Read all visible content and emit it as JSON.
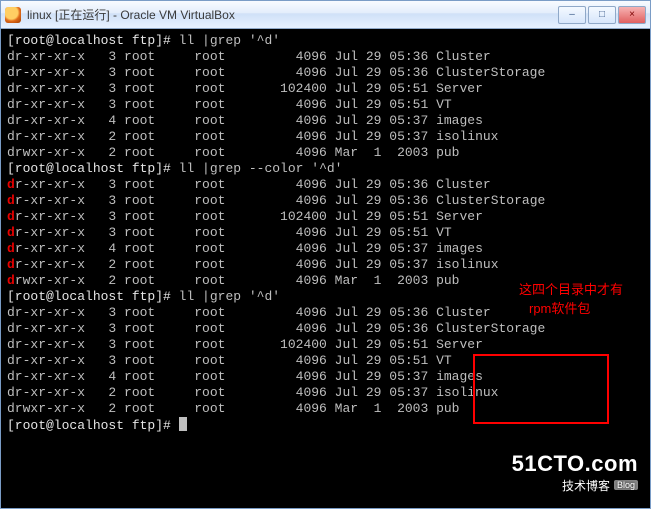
{
  "window": {
    "title": "linux [正在运行] - Oracle VM VirtualBox",
    "buttons": {
      "min": "–",
      "max": "□",
      "close": "×"
    }
  },
  "prompt": {
    "host": "[root@localhost ftp]# ",
    "cmd1": "ll |grep '^d'",
    "cmd2": "ll |grep --color '^d'",
    "cmd3": "ll |grep '^d'"
  },
  "listings": [
    {
      "perm": "dr-xr-xr-x",
      "links": "3",
      "owner": "root",
      "group": "root",
      "size": "4096",
      "date": "Jul 29 05:36",
      "name": "Cluster"
    },
    {
      "perm": "dr-xr-xr-x",
      "links": "3",
      "owner": "root",
      "group": "root",
      "size": "4096",
      "date": "Jul 29 05:36",
      "name": "ClusterStorage"
    },
    {
      "perm": "dr-xr-xr-x",
      "links": "3",
      "owner": "root",
      "group": "root",
      "size": "102400",
      "date": "Jul 29 05:51",
      "name": "Server"
    },
    {
      "perm": "dr-xr-xr-x",
      "links": "3",
      "owner": "root",
      "group": "root",
      "size": "4096",
      "date": "Jul 29 05:51",
      "name": "VT"
    },
    {
      "perm": "dr-xr-xr-x",
      "links": "4",
      "owner": "root",
      "group": "root",
      "size": "4096",
      "date": "Jul 29 05:37",
      "name": "images"
    },
    {
      "perm": "dr-xr-xr-x",
      "links": "2",
      "owner": "root",
      "group": "root",
      "size": "4096",
      "date": "Jul 29 05:37",
      "name": "isolinux"
    },
    {
      "perm": "drwxr-xr-x",
      "links": "2",
      "owner": "root",
      "group": "root",
      "size": "4096",
      "date": "Mar  1  2003",
      "name": "pub"
    }
  ],
  "annotation": {
    "line1": "这四个目录中才有",
    "line2": "rpm软件包"
  },
  "watermark": {
    "big": "51CTO.com",
    "small": "技术博客",
    "badge": "Blog"
  }
}
